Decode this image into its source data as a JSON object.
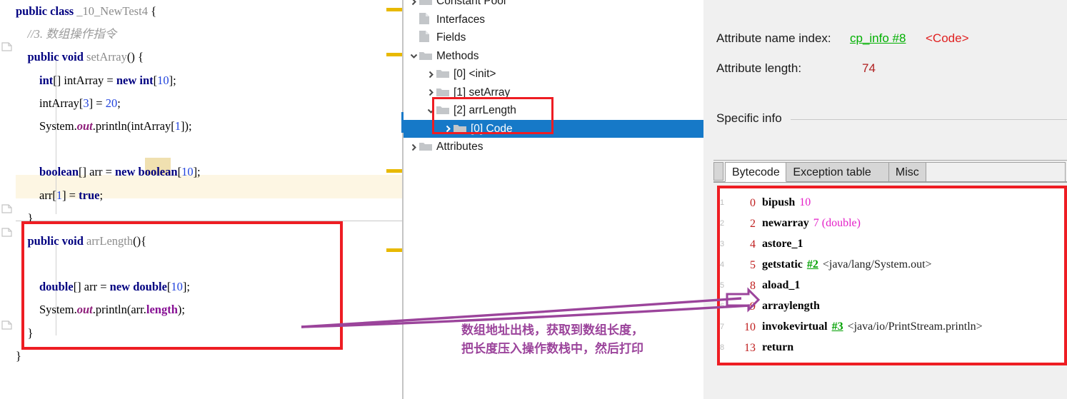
{
  "editor": {
    "lines": [
      {
        "id": "l1",
        "tokens": [
          {
            "t": "public",
            "c": "kw"
          },
          {
            "t": " ",
            "c": "plain"
          },
          {
            "t": "class",
            "c": "kw"
          },
          {
            "t": " ",
            "c": "plain"
          },
          {
            "t": "_10_NewTest4",
            "c": "mth"
          },
          {
            "t": " {",
            "c": "plain"
          }
        ]
      },
      {
        "id": "l2",
        "tokens": [
          {
            "t": "    //3. 数组操作指令",
            "c": "cmt"
          }
        ]
      },
      {
        "id": "l3",
        "tokens": [
          {
            "t": "    ",
            "c": "plain"
          },
          {
            "t": "public",
            "c": "kw"
          },
          {
            "t": " ",
            "c": "plain"
          },
          {
            "t": "void",
            "c": "kw"
          },
          {
            "t": " ",
            "c": "plain"
          },
          {
            "t": "setArray",
            "c": "mth"
          },
          {
            "t": "() {",
            "c": "plain"
          }
        ]
      },
      {
        "id": "l4",
        "tokens": [
          {
            "t": "        ",
            "c": "plain"
          },
          {
            "t": "int",
            "c": "kw"
          },
          {
            "t": "[] intArray = ",
            "c": "plain"
          },
          {
            "t": "new",
            "c": "kw"
          },
          {
            "t": " ",
            "c": "plain"
          },
          {
            "t": "int",
            "c": "kw"
          },
          {
            "t": "[",
            "c": "plain"
          },
          {
            "t": "10",
            "c": "num"
          },
          {
            "t": "];",
            "c": "plain"
          }
        ]
      },
      {
        "id": "l5",
        "tokens": [
          {
            "t": "        intArray[",
            "c": "plain"
          },
          {
            "t": "3",
            "c": "num"
          },
          {
            "t": "] = ",
            "c": "plain"
          },
          {
            "t": "20",
            "c": "num"
          },
          {
            "t": ";",
            "c": "plain"
          }
        ]
      },
      {
        "id": "l6",
        "tokens": [
          {
            "t": "        System.",
            "c": "plain"
          },
          {
            "t": "out",
            "c": "fld"
          },
          {
            "t": ".println(intArray[",
            "c": "plain"
          },
          {
            "t": "1",
            "c": "num"
          },
          {
            "t": "]);",
            "c": "plain"
          }
        ]
      },
      {
        "id": "l7",
        "tokens": [
          {
            "t": "",
            "c": "plain"
          }
        ]
      },
      {
        "id": "l8",
        "tokens": [
          {
            "t": "        ",
            "c": "plain"
          },
          {
            "t": "boolean",
            "c": "kw"
          },
          {
            "t": "[] arr = ",
            "c": "plain"
          },
          {
            "t": "new",
            "c": "kw"
          },
          {
            "t": " ",
            "c": "plain"
          },
          {
            "t": "boolean",
            "c": "kw"
          },
          {
            "t": "[",
            "c": "plain"
          },
          {
            "t": "10",
            "c": "num"
          },
          {
            "t": "];",
            "c": "plain"
          }
        ]
      },
      {
        "id": "l9",
        "tokens": [
          {
            "t": "        arr[",
            "c": "plain"
          },
          {
            "t": "1",
            "c": "num"
          },
          {
            "t": "] = ",
            "c": "plain"
          },
          {
            "t": "true",
            "c": "kw"
          },
          {
            "t": ";",
            "c": "plain"
          }
        ]
      },
      {
        "id": "l10",
        "tokens": [
          {
            "t": "    }",
            "c": "plain"
          }
        ]
      },
      {
        "id": "l11",
        "tokens": [
          {
            "t": "    ",
            "c": "plain"
          },
          {
            "t": "public",
            "c": "kw"
          },
          {
            "t": " ",
            "c": "plain"
          },
          {
            "t": "void",
            "c": "kw"
          },
          {
            "t": " ",
            "c": "plain"
          },
          {
            "t": "arrLength",
            "c": "mth"
          },
          {
            "t": "(){",
            "c": "plain"
          }
        ]
      },
      {
        "id": "l12",
        "tokens": [
          {
            "t": "",
            "c": "plain"
          }
        ]
      },
      {
        "id": "l13",
        "tokens": [
          {
            "t": "        ",
            "c": "plain"
          },
          {
            "t": "double",
            "c": "kw"
          },
          {
            "t": "[] arr = ",
            "c": "plain"
          },
          {
            "t": "new",
            "c": "kw"
          },
          {
            "t": " ",
            "c": "plain"
          },
          {
            "t": "double",
            "c": "kw"
          },
          {
            "t": "[",
            "c": "plain"
          },
          {
            "t": "10",
            "c": "num"
          },
          {
            "t": "];",
            "c": "plain"
          }
        ]
      },
      {
        "id": "l14",
        "tokens": [
          {
            "t": "        System.",
            "c": "plain"
          },
          {
            "t": "out",
            "c": "fld"
          },
          {
            "t": ".println(arr.",
            "c": "plain"
          },
          {
            "t": "length",
            "c": "prop"
          },
          {
            "t": ");",
            "c": "plain"
          }
        ]
      },
      {
        "id": "l15",
        "tokens": [
          {
            "t": "    }",
            "c": "plain"
          }
        ]
      },
      {
        "id": "l16",
        "tokens": [
          {
            "t": "}",
            "c": "plain"
          }
        ]
      }
    ],
    "highlighted_identifier": "arr",
    "marker_color": "#e8b900",
    "scrollbar_color": "#1a79c8",
    "annotation_box_color": "#ee1d23"
  },
  "tree": {
    "items": [
      {
        "label": "Constant Pool",
        "indent": 0,
        "twisty": "right",
        "icon": "folder-icon",
        "selected": false
      },
      {
        "label": "Interfaces",
        "indent": 0,
        "twisty": "none",
        "icon": "file-icon",
        "selected": false
      },
      {
        "label": "Fields",
        "indent": 0,
        "twisty": "none",
        "icon": "file-icon",
        "selected": false
      },
      {
        "label": "Methods",
        "indent": 0,
        "twisty": "down",
        "icon": "folder-icon",
        "selected": false
      },
      {
        "label": "[0] <init>",
        "indent": 1,
        "twisty": "right",
        "icon": "folder-icon",
        "selected": false
      },
      {
        "label": "[1] setArray",
        "indent": 1,
        "twisty": "right",
        "icon": "folder-icon",
        "selected": false
      },
      {
        "label": "[2] arrLength",
        "indent": 1,
        "twisty": "down",
        "icon": "folder-icon",
        "selected": false
      },
      {
        "label": "[0] Code",
        "indent": 2,
        "twisty": "right",
        "icon": "folder-icon",
        "selected": true
      },
      {
        "label": "Attributes",
        "indent": 0,
        "twisty": "right",
        "icon": "folder-icon",
        "selected": false
      }
    ],
    "selection_color": "#1679c8",
    "highlight_box_color": "#ee1d23"
  },
  "detail": {
    "attribute_name_index_label": "Attribute name index:",
    "attribute_name_index_value": "cp_info #8",
    "attribute_name_index_tag": "<Code>",
    "attribute_length_label": "Attribute length:",
    "attribute_length_value": "74",
    "specific_info_label": "Specific info",
    "tabs": [
      {
        "label": "Bytecode",
        "active": true
      },
      {
        "label": "Exception table",
        "active": false
      },
      {
        "label": "Misc",
        "active": false
      }
    ]
  },
  "bytecode": {
    "box_color": "#ee1d23",
    "instructions": [
      {
        "n": "1",
        "offset": "0",
        "op": "bipush",
        "imm": "10",
        "ref": "",
        "desc": ""
      },
      {
        "n": "2",
        "offset": "2",
        "op": "newarray",
        "imm": "7 (double)",
        "ref": "",
        "desc": ""
      },
      {
        "n": "3",
        "offset": "4",
        "op": "astore_1",
        "imm": "",
        "ref": "",
        "desc": ""
      },
      {
        "n": "4",
        "offset": "5",
        "op": "getstatic",
        "imm": "",
        "ref": "#2",
        "desc": "<java/lang/System.out>"
      },
      {
        "n": "5",
        "offset": "8",
        "op": "aload_1",
        "imm": "",
        "ref": "",
        "desc": ""
      },
      {
        "n": "6",
        "offset": "9",
        "op": "arraylength",
        "imm": "",
        "ref": "",
        "desc": ""
      },
      {
        "n": "7",
        "offset": "10",
        "op": "invokevirtual",
        "imm": "",
        "ref": "#3",
        "desc": "<java/io/PrintStream.println>"
      },
      {
        "n": "8",
        "offset": "13",
        "op": "return",
        "imm": "",
        "ref": "",
        "desc": ""
      }
    ]
  },
  "annotation": {
    "line1": "数组地址出栈，获取到数组长度，",
    "line2": "把长度压入操作数栈中，然后打印",
    "color": "#9b449b"
  }
}
